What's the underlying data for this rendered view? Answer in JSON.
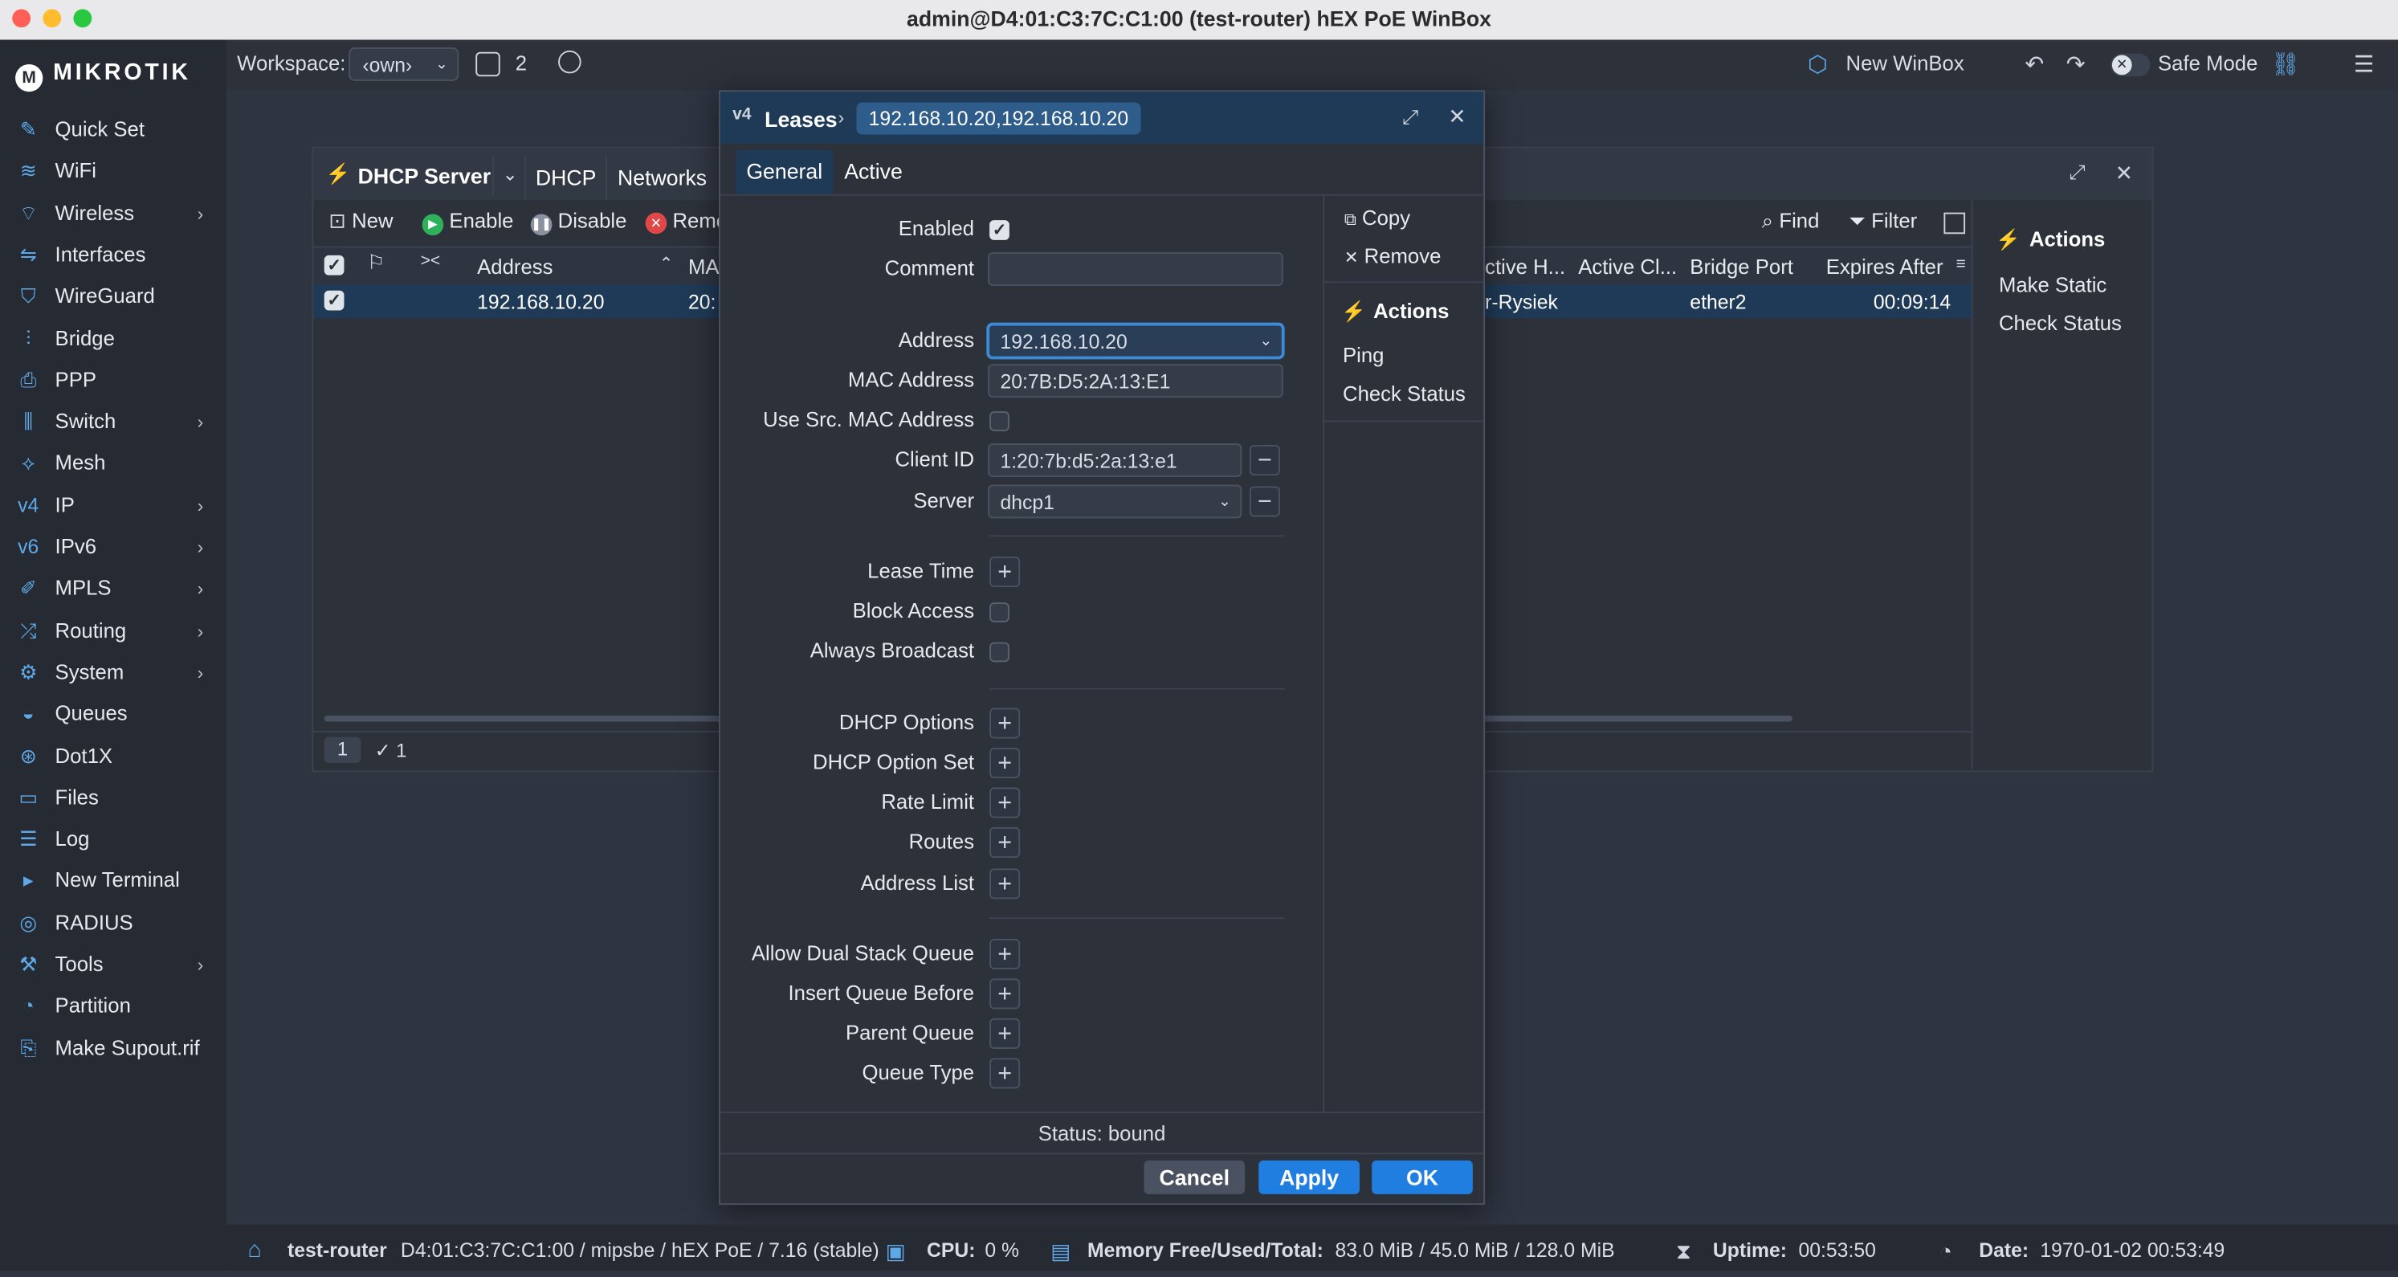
{
  "window": {
    "title": "admin@D4:01:C3:7C:C1:00 (test-router) hEX PoE WinBox"
  },
  "brand": {
    "logo_text": "MikroTik"
  },
  "topbar": {
    "workspace_label": "Workspace:",
    "workspace_value": "‹own›",
    "windows_count": "2",
    "new_winbox": "New WinBox",
    "safe_mode": "Safe Mode"
  },
  "sidebar": {
    "items": [
      {
        "label": "Quick Set",
        "icon": "wand-icon",
        "arrow": false
      },
      {
        "label": "WiFi",
        "icon": "wifi-icon",
        "arrow": false
      },
      {
        "label": "Wireless",
        "icon": "wireless-icon",
        "arrow": true
      },
      {
        "label": "Interfaces",
        "icon": "interfaces-icon",
        "arrow": false
      },
      {
        "label": "WireGuard",
        "icon": "shield-icon",
        "arrow": false
      },
      {
        "label": "Bridge",
        "icon": "bridge-icon",
        "arrow": false
      },
      {
        "label": "PPP",
        "icon": "ppp-icon",
        "arrow": false
      },
      {
        "label": "Switch",
        "icon": "switch-icon",
        "arrow": true
      },
      {
        "label": "Mesh",
        "icon": "mesh-icon",
        "arrow": false
      },
      {
        "label": "IP",
        "icon": "ipv4-icon",
        "arrow": true
      },
      {
        "label": "IPv6",
        "icon": "ipv6-icon",
        "arrow": true
      },
      {
        "label": "MPLS",
        "icon": "mpls-icon",
        "arrow": true
      },
      {
        "label": "Routing",
        "icon": "routing-icon",
        "arrow": true
      },
      {
        "label": "System",
        "icon": "gear-icon",
        "arrow": true
      },
      {
        "label": "Queues",
        "icon": "queues-icon",
        "arrow": false
      },
      {
        "label": "Dot1X",
        "icon": "dot1x-icon",
        "arrow": false
      },
      {
        "label": "Files",
        "icon": "folder-icon",
        "arrow": false
      },
      {
        "label": "Log",
        "icon": "log-icon",
        "arrow": false
      },
      {
        "label": "New Terminal",
        "icon": "terminal-icon",
        "arrow": false
      },
      {
        "label": "RADIUS",
        "icon": "radius-icon",
        "arrow": false
      },
      {
        "label": "Tools",
        "icon": "tools-icon",
        "arrow": true
      },
      {
        "label": "Partition",
        "icon": "partition-icon",
        "arrow": false
      },
      {
        "label": "Make Supout.rif",
        "icon": "supout-icon",
        "arrow": false
      }
    ]
  },
  "dhcp_window": {
    "title": "DHCP Server",
    "tabs": [
      "DHCP",
      "Networks"
    ],
    "toolbar": {
      "new": "New",
      "enable": "Enable",
      "disable": "Disable",
      "remove": "Remo",
      "find": "Find",
      "filter": "Filter"
    },
    "columns": {
      "address": "Address",
      "mac": "MAC",
      "active_host": "ctive H...",
      "active_client": "Active Cl...",
      "bridge_port": "Bridge Port",
      "expires": "Expires After"
    },
    "row": {
      "address": "192.168.10.20",
      "mac": "20:",
      "active_host": "r-Rysiek",
      "bridge_port": "ether2",
      "expires": "00:09:14"
    },
    "footer": {
      "count": "1",
      "selected": "1"
    },
    "actions": {
      "header": "Actions",
      "make_static": "Make Static",
      "check_status": "Check Status"
    }
  },
  "leases_window": {
    "title": "Leases",
    "breadcrumb": "192.168.10.20,192.168.10.20",
    "tabs": [
      "General",
      "Active"
    ],
    "fields": {
      "enabled": "Enabled",
      "comment": "Comment",
      "address": "Address",
      "mac_address": "MAC Address",
      "use_src_mac": "Use Src. MAC Address",
      "client_id": "Client ID",
      "server": "Server",
      "lease_time": "Lease Time",
      "block_access": "Block Access",
      "always_broadcast": "Always Broadcast",
      "dhcp_options": "DHCP Options",
      "dhcp_option_set": "DHCP Option Set",
      "rate_limit": "Rate Limit",
      "routes": "Routes",
      "address_list": "Address List",
      "allow_dual_stack": "Allow Dual Stack Queue",
      "insert_queue_before": "Insert Queue Before",
      "parent_queue": "Parent Queue",
      "queue_type": "Queue Type"
    },
    "values": {
      "address": "192.168.10.20",
      "mac_address": "20:7B:D5:2A:13:E1",
      "client_id": "1:20:7b:d5:2a:13:e1",
      "server": "dhcp1",
      "comment": ""
    },
    "side": {
      "copy": "Copy",
      "remove": "Remove",
      "actions": "Actions",
      "ping": "Ping",
      "check_status": "Check Status"
    },
    "status": "Status: bound",
    "buttons": {
      "cancel": "Cancel",
      "apply": "Apply",
      "ok": "OK"
    }
  },
  "statusbar": {
    "router": "test-router",
    "device": "D4:01:C3:7C:C1:00 / mipsbe / hEX PoE / 7.16 (stable)",
    "cpu_label": "CPU:",
    "cpu_value": "0 %",
    "mem_label": "Memory Free/Used/Total:",
    "mem_value": "83.0 MiB / 45.0 MiB / 128.0 MiB",
    "uptime_label": "Uptime:",
    "uptime_value": "00:53:50",
    "date_label": "Date:",
    "date_value": "1970-01-02 00:53:49"
  }
}
